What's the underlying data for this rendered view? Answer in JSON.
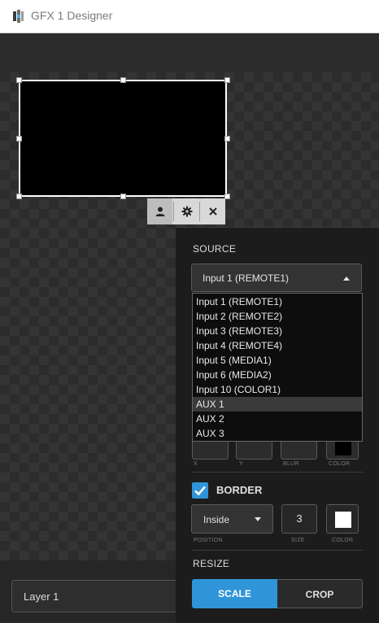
{
  "window": {
    "title": "GFX 1 Designer"
  },
  "layer": {
    "name": "Layer 1"
  },
  "context_toolbar": {
    "icons": [
      "person-icon",
      "gear-icon",
      "close-icon"
    ]
  },
  "panel": {
    "source": {
      "section_label": "SOURCE",
      "selected": "Input 1 (REMOTE1)",
      "options": [
        "Input 1 (REMOTE1)",
        "Input 2 (REMOTE2)",
        "Input 3 (REMOTE3)",
        "Input 4 (REMOTE4)",
        "Input 5 (MEDIA1)",
        "Input 6 (MEDIA2)",
        "Input 10 (COLOR1)",
        "AUX 1",
        "AUX 2",
        "AUX 3"
      ],
      "hovered_option": "AUX 1"
    },
    "shadow": {
      "labels": {
        "x": "X",
        "y": "Y",
        "blur": "BLUR",
        "color": "COLOR"
      },
      "color": "#000000"
    },
    "border": {
      "label": "BORDER",
      "enabled": true,
      "position": "Inside",
      "size": "3",
      "color": "#ffffff",
      "labels": {
        "position": "POSITION",
        "size": "SIZE",
        "color": "COLOR"
      }
    },
    "resize": {
      "section_label": "RESIZE",
      "options": [
        "SCALE",
        "CROP"
      ],
      "selected": "SCALE"
    }
  },
  "colors": {
    "accent": "#2f95d8",
    "panel_bg": "#1c1c1c"
  }
}
